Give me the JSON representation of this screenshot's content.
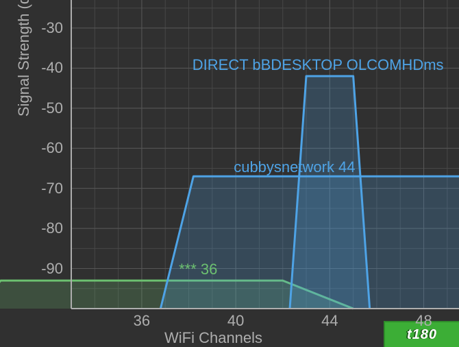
{
  "chart_data": {
    "type": "area",
    "title": "",
    "xlabel": "WiFi Channels",
    "ylabel": "Signal Strength (dBm)",
    "x_ticks": [
      36,
      40,
      44,
      48
    ],
    "y_ticks": [
      -30,
      -40,
      -50,
      -60,
      -70,
      -80,
      -90
    ],
    "xlim": [
      33,
      49.5
    ],
    "ylim": [
      -100,
      -23
    ],
    "series": [
      {
        "name": "*** 36",
        "color": "#6cc070",
        "channel_center": 36,
        "signal_dbm": -93,
        "label_x": 38.4,
        "label_y": -90,
        "shape": [
          {
            "x": 29,
            "y": -100
          },
          {
            "x": 30,
            "y": -93
          },
          {
            "x": 42,
            "y": -93
          },
          {
            "x": 45,
            "y": -100
          }
        ]
      },
      {
        "name": "cubbysnetwork 44",
        "color": "#4ea3e6",
        "channel_center": 44,
        "signal_dbm": -67,
        "label_x": 42.5,
        "label_y": -64.5,
        "shape": [
          {
            "x": 36.8,
            "y": -100
          },
          {
            "x": 38.2,
            "y": -67
          },
          {
            "x": 55,
            "y": -67
          },
          {
            "x": 56,
            "y": -100
          }
        ]
      },
      {
        "name": "DIRECT bBDESKTOP OLCOMHDms",
        "color": "#4ea3e6",
        "channel_center": 44,
        "signal_dbm": -42,
        "label_x": 43.5,
        "label_y": -39,
        "shape": [
          {
            "x": 42.3,
            "y": -100
          },
          {
            "x": 43,
            "y": -42
          },
          {
            "x": 45,
            "y": -42
          },
          {
            "x": 45.7,
            "y": -100
          }
        ]
      }
    ]
  },
  "badge": {
    "text": "t180"
  }
}
